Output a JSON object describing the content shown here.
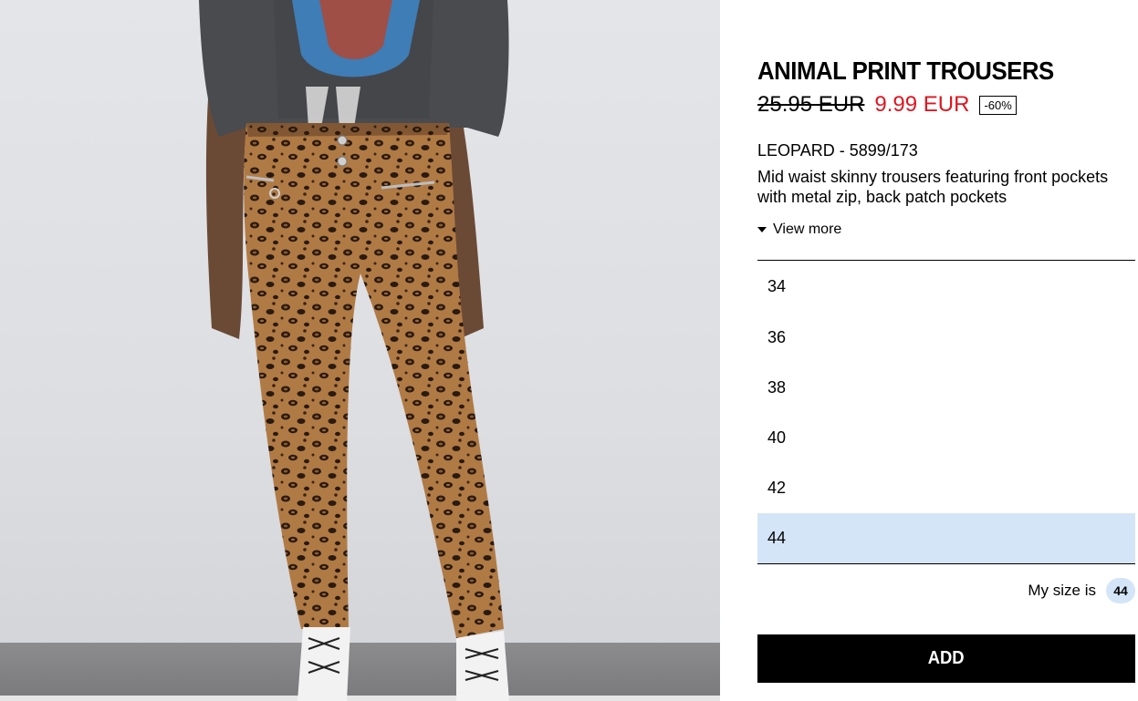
{
  "product": {
    "title": "ANIMAL PRINT TROUSERS",
    "old_price": "25.95 EUR",
    "new_price": "9.99 EUR",
    "discount": "-60%",
    "reference": "LEOPARD - 5899/173",
    "description": "Mid waist skinny trousers featuring front pockets with metal zip, back patch pockets",
    "view_more_label": "View more"
  },
  "sizes": {
    "options": [
      "34",
      "36",
      "38",
      "40",
      "42",
      "44"
    ],
    "selected": "44"
  },
  "my_size": {
    "label": "My size is",
    "value": "44"
  },
  "actions": {
    "add_label": "ADD"
  },
  "colors": {
    "sale_price": "#e0151f",
    "selected_size_bg": "#d5e5f8",
    "button_bg": "#000000"
  }
}
